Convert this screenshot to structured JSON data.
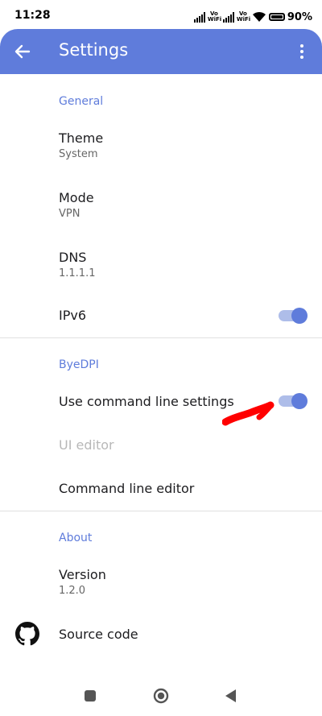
{
  "status_bar": {
    "time": "11:28",
    "vowifi_1": "Vo\nWiFi",
    "vowifi_2": "Vo\nWiFi",
    "battery_text": "90%"
  },
  "app_bar": {
    "title": "Settings",
    "back_icon": "arrow-back-icon",
    "menu_icon": "more-vert-icon",
    "color": "#5f7cdb"
  },
  "sections": {
    "general": {
      "header": "General",
      "theme": {
        "title": "Theme",
        "summary": "System"
      },
      "mode": {
        "title": "Mode",
        "summary": "VPN"
      },
      "dns": {
        "title": "DNS",
        "summary": "1.1.1.1"
      },
      "ipv6": {
        "title": "IPv6",
        "checked": true
      }
    },
    "byedpi": {
      "header": "ByeDPI",
      "use_cmd": {
        "title": "Use command line settings",
        "checked": true
      },
      "ui_editor": {
        "title": "UI editor",
        "enabled": false
      },
      "cmd_editor": {
        "title": "Command line editor"
      }
    },
    "about": {
      "header": "About",
      "version": {
        "title": "Version",
        "summary": "1.2.0"
      },
      "source": {
        "title": "Source code",
        "icon": "github-icon"
      }
    }
  },
  "colors": {
    "accent": "#5f7cdb",
    "switch_track": "#aebde9",
    "annotation": "#ff0000"
  }
}
